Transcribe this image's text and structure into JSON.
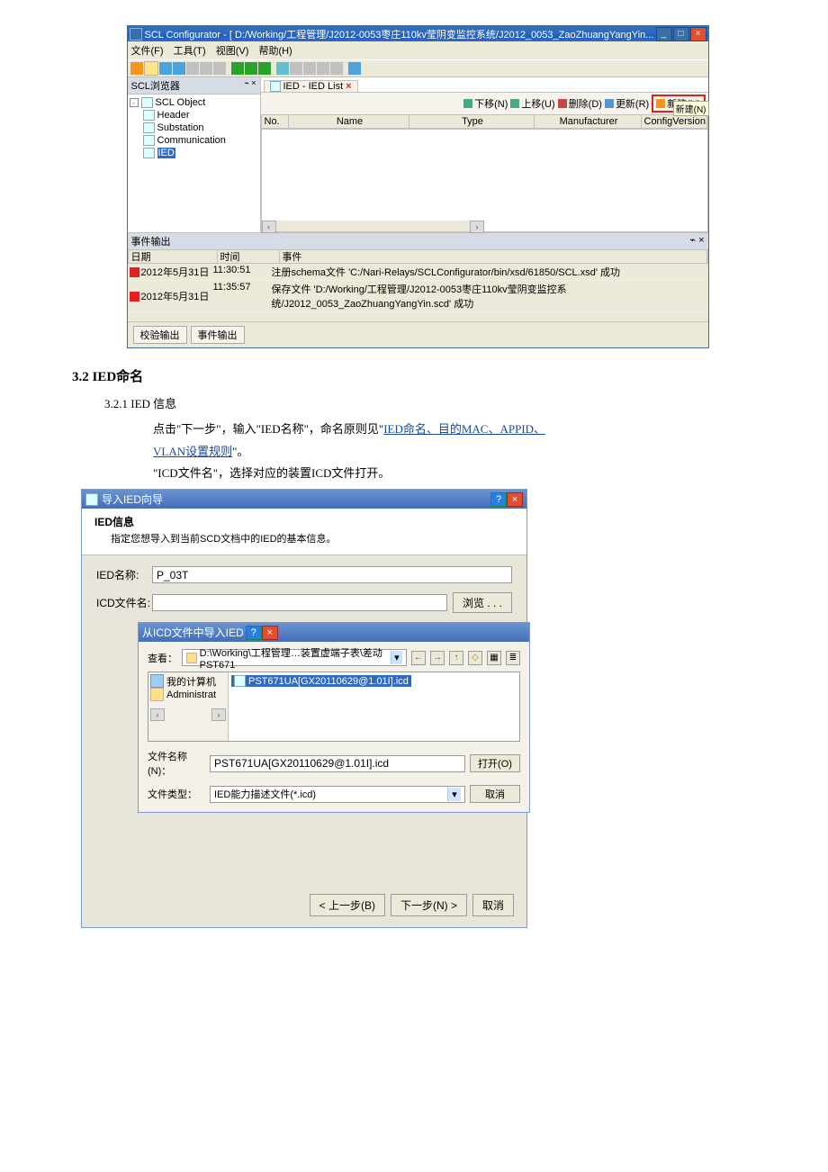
{
  "scl": {
    "title": "SCL Configurator - [ D:/Working/工程管理/J2012-0053枣庄110kv莹阴变监控系统/J2012_0053_ZaoZhuangYangYin...",
    "wmin": "_",
    "wmax": "□",
    "wclose": "×",
    "menu": {
      "file": "文件(F)",
      "tool": "工具(T)",
      "view": "视图(V)",
      "help": "帮助(H)"
    },
    "browser": {
      "title": "SCL浏览器",
      "pin": "⌁ ×",
      "root": "SCL Object",
      "header": "Header",
      "substation": "Substation",
      "communication": "Communication",
      "ied": "IED"
    },
    "tab": {
      "label": "IED - IED List",
      "close": "×"
    },
    "cmd": {
      "down": "下移(N)",
      "up": "上移(U)",
      "del": "删除(D)",
      "upd": "更新(R)",
      "add": "新建(N)"
    },
    "cols": {
      "no": "No.",
      "name": "Name",
      "type": "Type",
      "manu": "Manufacturer",
      "conf": "ConfigVersion"
    },
    "tooltip": "新建(N)",
    "scroll_l": "‹",
    "scroll_r": "›",
    "events": {
      "title": "事件输出",
      "pin": "⌁ ×",
      "h_date": "日期",
      "h_time": "时间",
      "h_event": "事件",
      "r1_date": "2012年5月31日",
      "r1_time": "11:30:51",
      "r1_msg": "注册schema文件 'C:/Nari-Relays/SCLConfigurator/bin/xsd/61850/SCL.xsd' 成功",
      "r2_date": "2012年5月31日",
      "r2_time": "11:35:57",
      "r2_msg": "保存文件 'D:/Working/工程管理/J2012-0053枣庄110kv莹阴变监控系统/J2012_0053_ZaoZhuangYangYin.scd' 成功"
    },
    "btab1": "校验输出",
    "btab2": "事件输出"
  },
  "doc": {
    "sec": "3.2   IED命名",
    "sub": "3.2.1 IED 信息",
    "p1a": "点击\"下一步\"，输入\"IED名称\"，命名原则见\"",
    "link1": "IED命名、目的MAC、APPID、",
    "link2": "VLAN设置规则",
    "p1b": "\"。",
    "p2": "\"ICD文件名\"，选择对应的装置ICD文件打开。"
  },
  "wiz": {
    "title": "导入IED向导",
    "help": "?",
    "close": "×",
    "hdr": "IED信息",
    "sub": "指定您想导入到当前SCD文档中的IED的基本信息。",
    "lbl_name": "IED名称:",
    "val_name": "P_03T",
    "lbl_file": "ICD文件名:",
    "val_file": "",
    "browse": "浏览 . . .",
    "filedlg": {
      "title": "从ICD文件中导入IED",
      "help": "?",
      "close": "×",
      "look": "查看：",
      "dir": "D:\\Working\\工程管理…装置虚端子表\\差动PST671",
      "chev": "▾",
      "back": "←",
      "fwd": "→",
      "up": "↑",
      "new": "◇",
      "grid": "▦",
      "list": "≣",
      "mycomp": "我的计算机",
      "admin": "Administrat",
      "sel": "PST671UA[GX20110629@1.01I].icd",
      "lbl_fn": "文件名称(N)：",
      "val_fn": "PST671UA[GX20110629@1.01I].icd",
      "open": "打开(O)",
      "lbl_ft": "文件类型：",
      "val_ft": "IED能力描述文件(*.icd)",
      "cancel": "取消",
      "scroll_l": "‹",
      "scroll_r": "›"
    },
    "prev": "< 上一步(B)",
    "next": "下一步(N) >",
    "cancel": "取消"
  }
}
